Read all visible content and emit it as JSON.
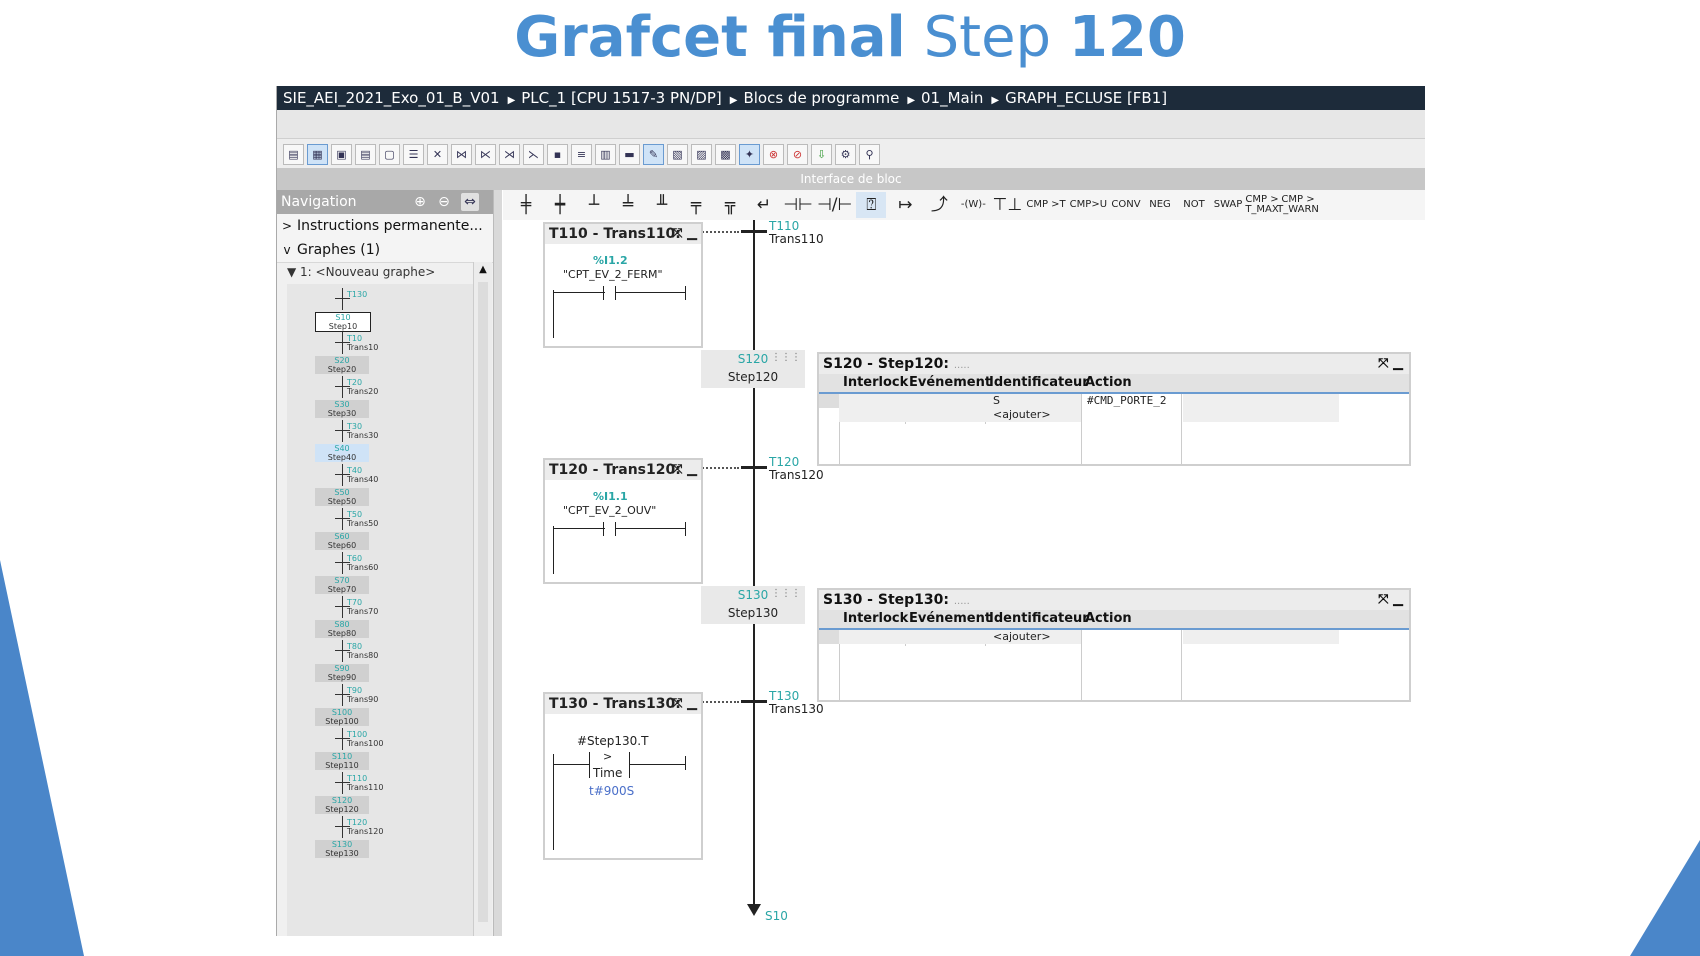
{
  "slide": {
    "title_bold1": "Grafcet final",
    "title_light": "Step",
    "title_bold2": "120"
  },
  "breadcrumb": [
    "SIE_AEI_2021_Exo_01_B_V01",
    "PLC_1 [CPU 1517-3 PN/DP]",
    "Blocs de programme",
    "01_Main",
    "GRAPH_ECLUSE [FB1]"
  ],
  "interface_label": "Interface de bloc",
  "navigation": {
    "title": "Navigation",
    "rows": [
      {
        "label": "Instructions permanente...",
        "chevron": ">"
      },
      {
        "label": "Graphes (1)",
        "chevron": "v"
      }
    ],
    "graph_item": "1: <Nouveau graphe>",
    "tree": [
      {
        "kind": "trans",
        "num": "T130",
        "label": ""
      },
      {
        "kind": "step",
        "num": "S10",
        "label": "Step10"
      },
      {
        "kind": "trans",
        "num": "T10",
        "label": "Trans10"
      },
      {
        "kind": "step",
        "num": "S20",
        "label": "Step20"
      },
      {
        "kind": "trans",
        "num": "T20",
        "label": "Trans20"
      },
      {
        "kind": "step",
        "num": "S30",
        "label": "Step30"
      },
      {
        "kind": "trans",
        "num": "T30",
        "label": "Trans30"
      },
      {
        "kind": "step",
        "num": "S40",
        "label": "Step40"
      },
      {
        "kind": "trans",
        "num": "T40",
        "label": "Trans40"
      },
      {
        "kind": "step",
        "num": "S50",
        "label": "Step50"
      },
      {
        "kind": "trans",
        "num": "T50",
        "label": "Trans50"
      },
      {
        "kind": "step",
        "num": "S60",
        "label": "Step60"
      },
      {
        "kind": "trans",
        "num": "T60",
        "label": "Trans60"
      },
      {
        "kind": "step",
        "num": "S70",
        "label": "Step70"
      },
      {
        "kind": "trans",
        "num": "T70",
        "label": "Trans70"
      },
      {
        "kind": "step",
        "num": "S80",
        "label": "Step80"
      },
      {
        "kind": "trans",
        "num": "T80",
        "label": "Trans80"
      },
      {
        "kind": "step",
        "num": "S90",
        "label": "Step90"
      },
      {
        "kind": "trans",
        "num": "T90",
        "label": "Trans90"
      },
      {
        "kind": "step",
        "num": "S100",
        "label": "Step100"
      },
      {
        "kind": "trans",
        "num": "T100",
        "label": "Trans100"
      },
      {
        "kind": "step",
        "num": "S110",
        "label": "Step110"
      },
      {
        "kind": "trans",
        "num": "T110",
        "label": "Trans110"
      },
      {
        "kind": "step",
        "num": "S120",
        "label": "Step120"
      },
      {
        "kind": "trans",
        "num": "T120",
        "label": "Trans120"
      },
      {
        "kind": "step",
        "num": "S130",
        "label": "Step130"
      }
    ]
  },
  "toolbar2": [
    "CMP >T",
    "CMP>U",
    "CONV",
    "NEG",
    "NOT",
    "SWAP",
    "CMP > T_MAX",
    "CMP > T_WARN"
  ],
  "graph": {
    "transitions": [
      {
        "id": "T110",
        "name": "Trans110",
        "box_title": "T110 - Trans110:",
        "addr": "%I1.2",
        "tag": "\"CPT_EV_2_FERM\""
      },
      {
        "id": "T120",
        "name": "Trans120",
        "box_title": "T120 - Trans120:",
        "addr": "%I1.1",
        "tag": "\"CPT_EV_2_OUV\""
      },
      {
        "id": "T130",
        "name": "Trans130",
        "box_title": "T130 - Trans130:",
        "cmp_in": "#Step130.T",
        "cmp_op": ">",
        "cmp_type": "Time",
        "cmp_val": "t#900S"
      }
    ],
    "steps": [
      {
        "id": "S120",
        "name": "Step120",
        "panel_title": "S120 - Step120:",
        "dots": ".....",
        "actions": [
          {
            "id": "S",
            "action": "#CMD_PORTE_2"
          },
          {
            "id": "<ajouter>",
            "action": ""
          }
        ]
      },
      {
        "id": "S130",
        "name": "Step130",
        "panel_title": "S130 - Step130:",
        "dots": ".....",
        "actions": [
          {
            "id": "<ajouter>",
            "action": ""
          }
        ]
      }
    ],
    "columns": [
      "Interlock",
      "Evénement",
      "Identificateur",
      "Action"
    ],
    "jump": "S10"
  }
}
